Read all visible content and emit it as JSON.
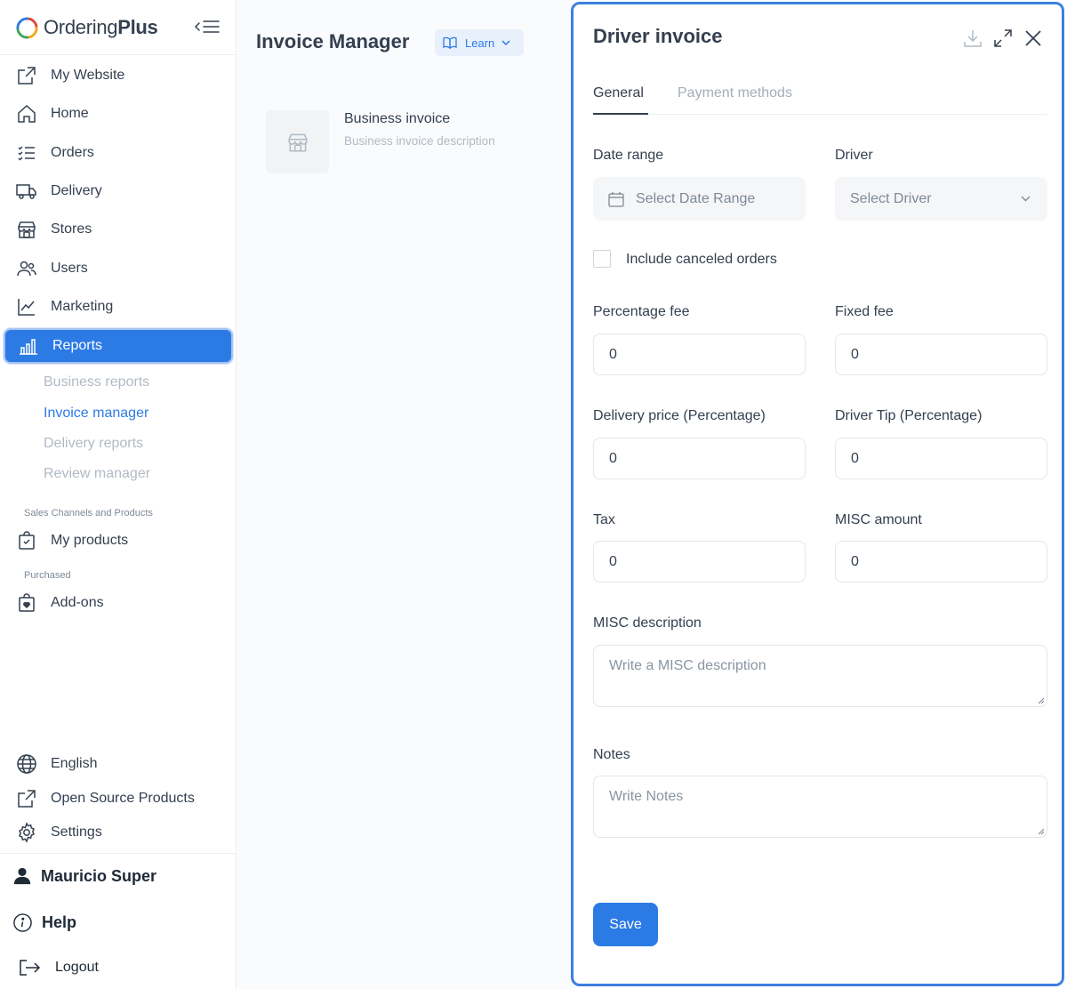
{
  "sidebar": {
    "brand_name_regular": "Ordering",
    "brand_name_bold": "Plus",
    "nav": [
      {
        "label": "My Website"
      },
      {
        "label": "Home"
      },
      {
        "label": "Orders"
      },
      {
        "label": "Delivery"
      },
      {
        "label": "Stores"
      },
      {
        "label": "Users"
      },
      {
        "label": "Marketing"
      },
      {
        "label": "Reports"
      }
    ],
    "reports_sub": [
      {
        "label": "Business reports"
      },
      {
        "label": "Invoice manager"
      },
      {
        "label": "Delivery reports"
      },
      {
        "label": "Review manager"
      }
    ],
    "group_sales": "Sales Channels and Products",
    "my_products": "My products",
    "group_purchased": "Purchased",
    "addons": "Add-ons",
    "language": "English",
    "open_source": "Open Source Products",
    "settings": "Settings",
    "user_name": "Mauricio Super",
    "help": "Help",
    "logout": "Logout"
  },
  "main": {
    "title": "Invoice Manager",
    "learn_label": "Learn",
    "invoice_card": {
      "title": "Business invoice",
      "description": "Business invoice description"
    }
  },
  "panel": {
    "title": "Driver invoice",
    "tabs": [
      {
        "label": "General"
      },
      {
        "label": "Payment methods"
      }
    ],
    "date_range_label": "Date range",
    "date_range_placeholder": "Select Date Range",
    "driver_label": "Driver",
    "driver_placeholder": "Select Driver",
    "include_canceled_label": "Include canceled orders",
    "percentage_fee_label": "Percentage fee",
    "percentage_fee_value": "0",
    "fixed_fee_label": "Fixed fee",
    "fixed_fee_value": "0",
    "delivery_price_label": "Delivery price (Percentage)",
    "delivery_price_value": "0",
    "driver_tip_label": "Driver Tip (Percentage)",
    "driver_tip_value": "0",
    "tax_label": "Tax",
    "tax_value": "0",
    "misc_amount_label": "MISC amount",
    "misc_amount_value": "0",
    "misc_description_label": "MISC description",
    "misc_description_placeholder": "Write a MISC description",
    "notes_label": "Notes",
    "notes_placeholder": "Write Notes",
    "save_label": "Save"
  },
  "colors": {
    "accent": "#2c7be5",
    "panel_border": "#3d7fe0",
    "text": "#344050",
    "muted": "#b1bac4"
  }
}
